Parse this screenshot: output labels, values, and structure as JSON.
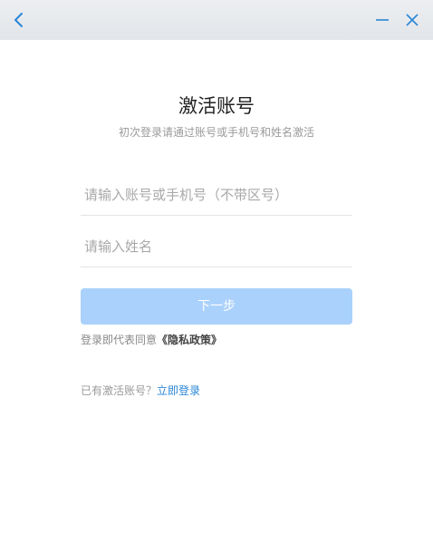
{
  "header": {
    "back_icon": "chevron-left-icon",
    "minimize_icon": "minimize-icon",
    "close_icon": "close-icon",
    "icon_color": "#2a86d6"
  },
  "main": {
    "title": "激活账号",
    "subtitle": "初次登录请通过账号或手机号和姓名激活",
    "account_input": {
      "value": "",
      "placeholder": "请输入账号或手机号（不带区号）"
    },
    "name_input": {
      "value": "",
      "placeholder": "请输入姓名"
    },
    "next_button_label": "下一步",
    "next_button_color": "#aad1fb",
    "policy_prefix": "登录即代表同意",
    "policy_link": "《隐私政策》",
    "login_prompt": "已有激活账号？",
    "login_link": "立即登录",
    "link_color": "#2a86d6"
  }
}
